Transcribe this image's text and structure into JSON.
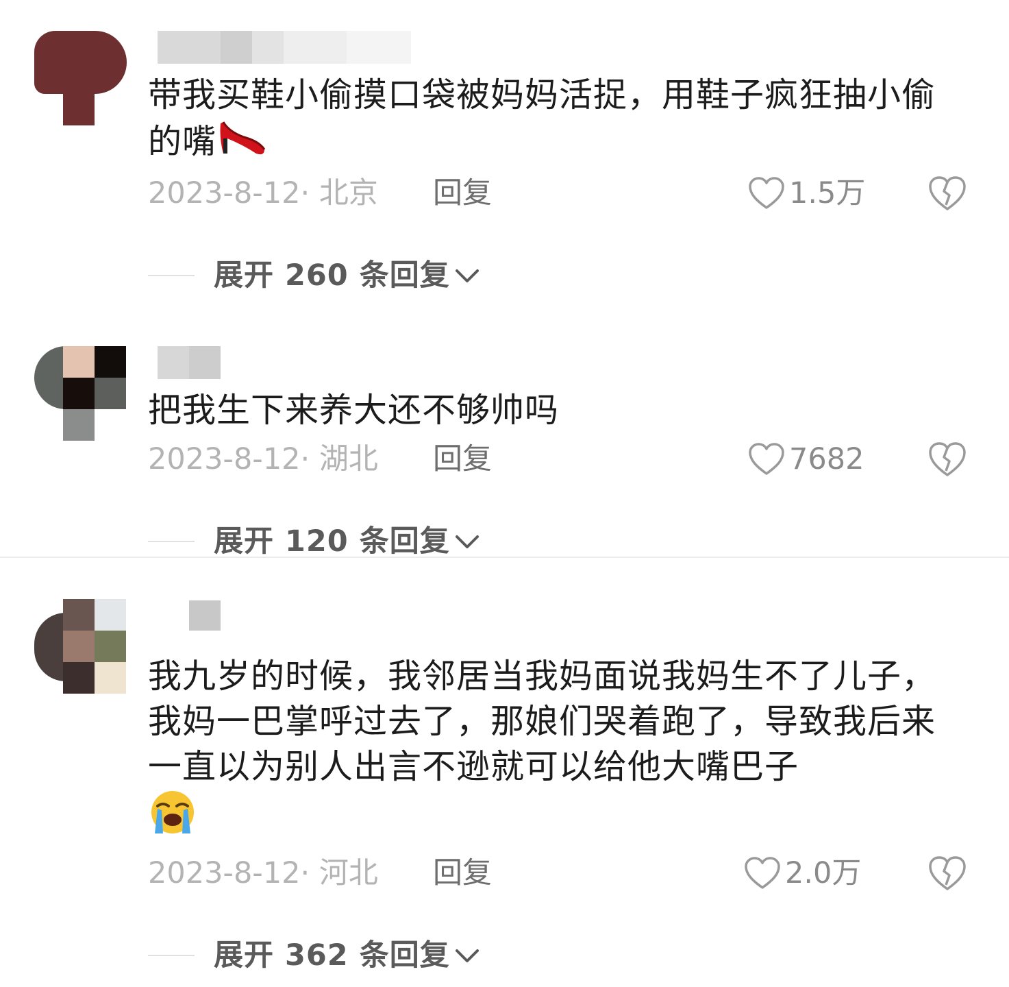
{
  "comments": [
    {
      "text": "带我买鞋小偷摸口袋被妈妈活捉，用鞋子疯狂抽小偷的嘴",
      "emoji": "high-heel-shoe",
      "date": "2023-8-12· 北京",
      "reply_label": "回复",
      "likes": "1.5万",
      "expand_label": "展开 260 条回复"
    },
    {
      "text": "把我生下来养大还不够帅吗",
      "date": "2023-8-12· 湖北",
      "reply_label": "回复",
      "likes": "7682",
      "expand_label": "展开 120 条回复"
    },
    {
      "text": "我九岁的时候，我邻居当我妈面说我妈生不了儿子，我妈一巴掌呼过去了，那娘们哭着跑了，导致我后来一直以为别人出言不逊就可以给他大嘴巴子",
      "emoji": "loudly-crying-face",
      "date": "2023-8-12· 河北",
      "reply_label": "回复",
      "likes": "2.0万",
      "expand_label": "展开 362 条回复"
    }
  ]
}
